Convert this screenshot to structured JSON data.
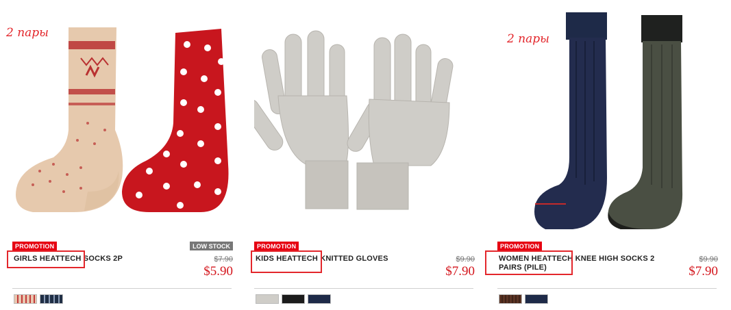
{
  "products": [
    {
      "promo": "PROMOTION",
      "badge": "LOW STOCK",
      "name": "GIRLS HEATTECH SOCKS 2P",
      "old_price": "$7.90",
      "price": "$5.90",
      "note": "2 пары",
      "swatches": [
        "#e8c7b0",
        "#1f2e45"
      ]
    },
    {
      "promo": "PROMOTION",
      "name": "KIDS HEATTECH KNITTED GLOVES",
      "old_price": "$9.90",
      "price": "$7.90",
      "swatches": [
        "#cfcdc8",
        "#1c1c1c",
        "#1e2a48"
      ]
    },
    {
      "promo": "PROMOTION",
      "name": "WOMEN HEATTECH KNEE HIGH SOCKS 2 PAIRS (PILE)",
      "old_price": "$9.90",
      "price": "$7.90",
      "note": "2 пары",
      "swatches": [
        "#5a3323",
        "#1e2a48"
      ]
    }
  ],
  "colors": {
    "promo": "#e60012",
    "price": "#d4161d",
    "annotation": "#e3262b"
  }
}
